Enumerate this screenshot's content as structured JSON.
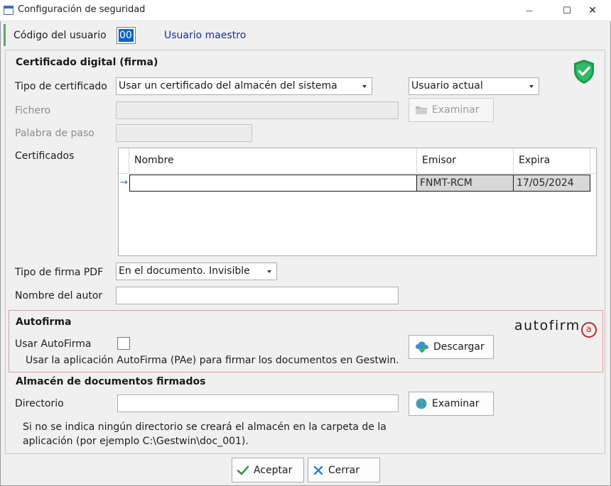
{
  "window": {
    "title": "Configuración de seguridad",
    "minimize_glyph": "—",
    "maximize_glyph": "☐",
    "close_glyph": "✕"
  },
  "header": {
    "user_code_label": "Código del usuario",
    "user_code_value": "00",
    "user_name": "Usuario maestro"
  },
  "certificado": {
    "section_title": "Certificado digital (firma)",
    "tipo_label": "Tipo de certificado",
    "tipo_value": "Usar un certificado del almacén del sistema",
    "usuario_value": "Usuario actual",
    "fichero_label": "Fichero",
    "fichero_value": "",
    "examinar_label": "Examinar",
    "palabra_label": "Palabra de paso",
    "palabra_value": "",
    "certificados_label": "Certificados",
    "columns": [
      "Nombre",
      "Emisor",
      "Expira"
    ],
    "rows": [
      {
        "nombre": "",
        "emisor": "FNMT-RCM",
        "expira": "17/05/2024"
      }
    ],
    "shield_icon": "shield-check-icon",
    "accent_color": "#22a35a"
  },
  "firma_pdf": {
    "label": "Tipo de firma PDF",
    "value": "En el documento. Invisible"
  },
  "autor": {
    "label": "Nombre del autor",
    "value": ""
  },
  "autofirma": {
    "section_title": "Autofirma",
    "usar_label": "Usar AutoFirma",
    "checked": false,
    "description": "Usar la aplicación AutoFirma (PAe) para firmar los documentos en Gestwin.",
    "descargar_label": "Descargar",
    "logo_text": "autofirm",
    "logo_at": "a",
    "border_color": "#e89a9a"
  },
  "almacen": {
    "section_title": "Almacén de documentos firmados",
    "directorio_label": "Directorio",
    "directorio_value": "",
    "examinar_label": "Examinar",
    "note_line1": "Si no se indica ningún directorio se creará el almacén en la carpeta de la",
    "note_line2": "aplicación (por ejemplo C:\\Gestwin\\doc_001)."
  },
  "footer": {
    "aceptar_label": "Aceptar",
    "cerrar_label": "Cerrar"
  }
}
